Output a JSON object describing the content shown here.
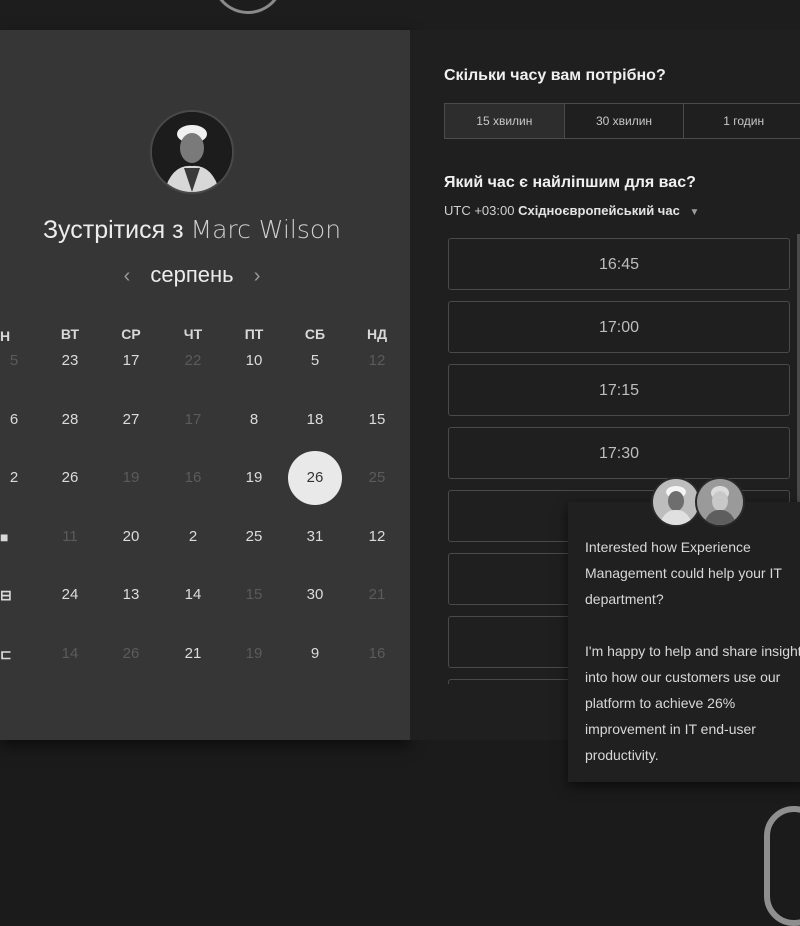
{
  "calendar": {
    "title_prefix": "Зустрітися з",
    "host_name": "Marc Wilson",
    "month": "серпень",
    "prev_arrow": "‹",
    "next_arrow": "›",
    "weekdays": [
      "ВТ",
      "СР",
      "ЧТ",
      "ПТ",
      "СБ",
      "НД"
    ],
    "days": [
      [
        "5",
        "23",
        "17",
        "22",
        "10",
        "5",
        "12"
      ],
      [
        "6",
        "28",
        "27",
        "17",
        "8",
        "18",
        "15"
      ],
      [
        "2",
        "26",
        "19",
        "16",
        "19",
        "26",
        "25"
      ],
      [
        "",
        "11",
        "20",
        "2",
        "25",
        "31",
        "12"
      ],
      [
        "",
        "24",
        "13",
        "14",
        "15",
        "30",
        "21"
      ],
      [
        "",
        "14",
        "26",
        "21",
        "19",
        "9",
        "16"
      ]
    ],
    "muted": [
      [
        true,
        false,
        false,
        true,
        false,
        false,
        true
      ],
      [
        false,
        false,
        false,
        true,
        false,
        false,
        false
      ],
      [
        false,
        false,
        true,
        true,
        false,
        false,
        true
      ],
      [
        false,
        true,
        false,
        false,
        false,
        false,
        false
      ],
      [
        false,
        false,
        false,
        false,
        true,
        false,
        true
      ],
      [
        false,
        true,
        true,
        false,
        true,
        false,
        true
      ]
    ],
    "selected_day": "26"
  },
  "booking": {
    "duration_question": "Скільки часу вам потрібно?",
    "durations": [
      "15 хвилин",
      "30 хвилин",
      "1 годин"
    ],
    "time_question": "Який час є найліпшим для вас?",
    "tz_offset": "UTC +03:00",
    "tz_name": "Східноєвропейський час",
    "slots": [
      "16:45",
      "17:00",
      "17:15",
      "17:30",
      "",
      "",
      "",
      ""
    ]
  },
  "chat": {
    "paragraph1": "Interested how Experience Management could help your IT department?",
    "paragraph2": "I'm happy to help and share insight into how our customers use our platform to achieve 26% improvement in IT end-user productivity."
  }
}
